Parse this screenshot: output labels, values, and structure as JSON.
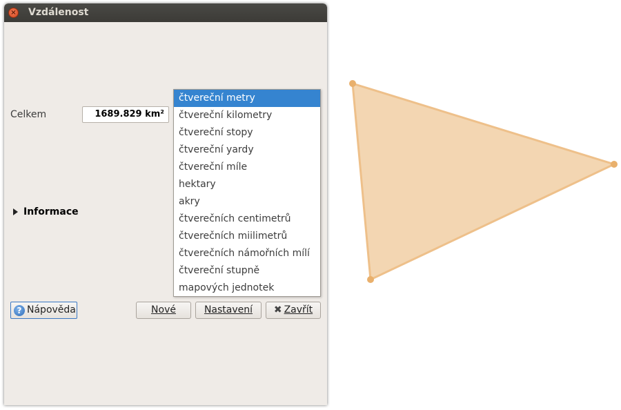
{
  "window": {
    "title": "Vzdálenost"
  },
  "total": {
    "label": "Celkem",
    "value": "1689.829 km²"
  },
  "unit_options": [
    "čtvereční metry",
    "čtvereční kilometry",
    "čtvereční stopy",
    "čtvereční yardy",
    "čtvereční míle",
    "hektary",
    "akry",
    "čtverečních centimetrů",
    "čtverečních miilimetrů",
    "čtverečních námořních mílí",
    "čtvereční stupně",
    "mapových jednotek"
  ],
  "selected_unit": "čtvereční metry",
  "info_section": {
    "label": "Informace"
  },
  "buttons": {
    "help": "Nápověda",
    "new": "Nové",
    "settings": "Nastavení",
    "close": "Zavřít"
  },
  "colors": {
    "polygon_fill": "#f3d6b2",
    "polygon_stroke": "#eec08a",
    "vertex": "#e9b06c",
    "selection": "#3584d0"
  }
}
